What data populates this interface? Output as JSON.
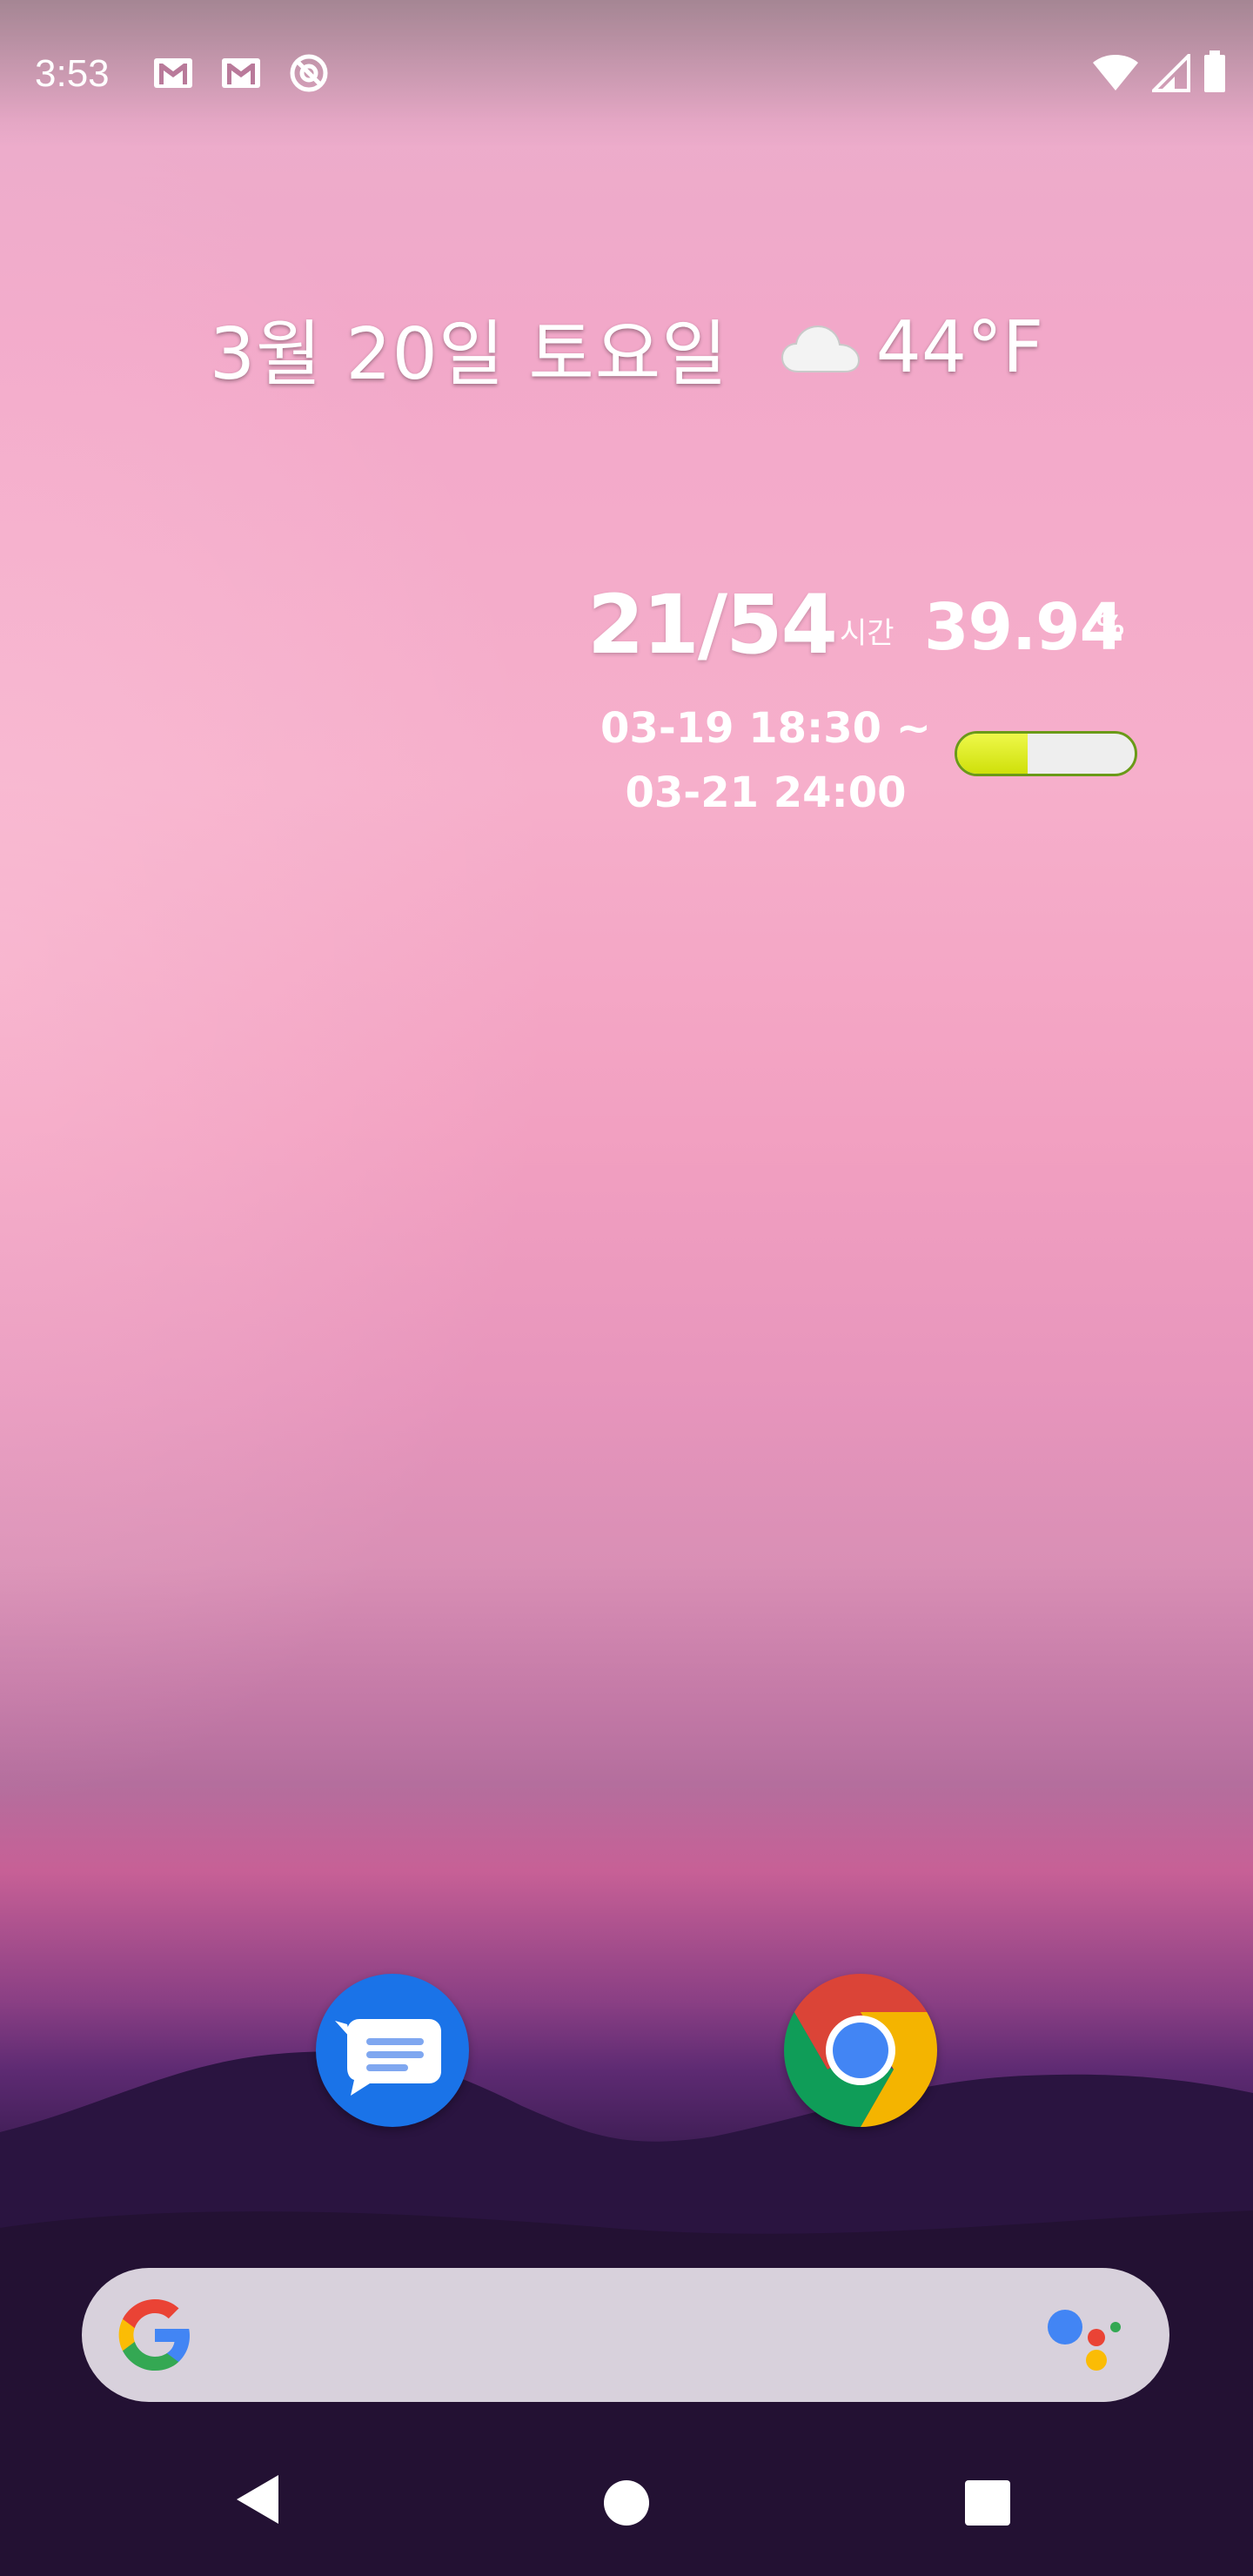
{
  "status_bar": {
    "time": "3:53",
    "left_icons": [
      "gmail-icon",
      "gmail-icon",
      "do-not-disturb-icon"
    ],
    "right_icons": [
      "wifi-icon",
      "cell-signal-icon",
      "battery-icon"
    ]
  },
  "date_widget": {
    "date": "3월 20일 토요일",
    "weather_icon": "cloud-icon",
    "temperature": "44°F"
  },
  "usage_widget": {
    "hours": "21/54",
    "unit": "시간",
    "percent": "39.94",
    "percent_sign": "%",
    "range_start": "03-19 18:30 ~",
    "range_end": "03-21 24:00",
    "progress_fraction": 0.3994,
    "bar_color": "#cfe00a"
  },
  "dock": {
    "apps": [
      {
        "name": "Messages",
        "icon": "messages-icon"
      },
      {
        "name": "Chrome",
        "icon": "chrome-icon"
      }
    ]
  },
  "search": {
    "logo": "google-g-icon",
    "assistant": "google-assistant-icon"
  },
  "nav": {
    "back": "back-icon",
    "home": "home-icon",
    "recents": "recents-icon"
  }
}
